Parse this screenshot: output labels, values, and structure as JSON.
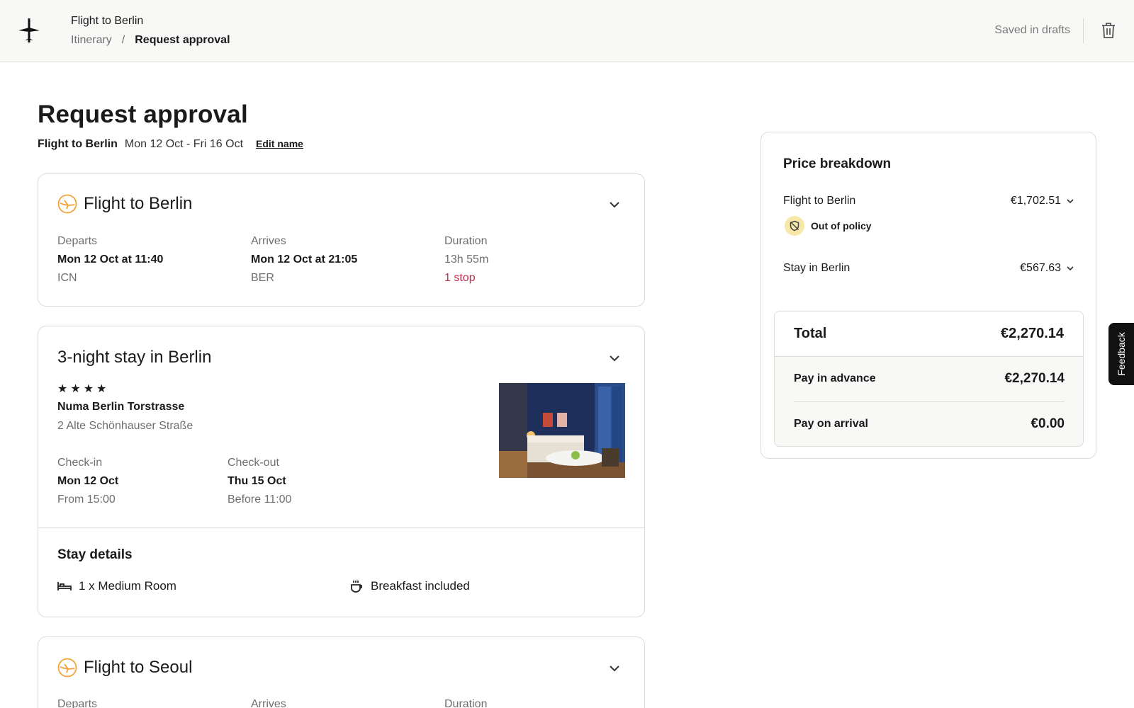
{
  "topbar": {
    "title": "Flight to Berlin",
    "breadcrumb": [
      "Itinerary",
      "Request approval"
    ],
    "breadcrumb_separator": "/",
    "status": "Saved in drafts",
    "logo_icon": "plane-icon",
    "delete_icon": "trash-icon"
  },
  "header": {
    "title": "Request approval",
    "trip_name": "Flight to Berlin",
    "dates": "Mon 12 Oct - Fri 16 Oct",
    "edit_label": "Edit name"
  },
  "flight_out": {
    "title": "Flight to Berlin",
    "departs_label": "Departs",
    "departs": "Mon 12 Oct at 11:40",
    "departs_airport": "ICN",
    "arrives_label": "Arrives",
    "arrives": "Mon 12 Oct at 21:05",
    "arrives_airport": "BER",
    "duration_label": "Duration",
    "duration": "13h 55m",
    "stops": "1 stop"
  },
  "stay": {
    "title": "3-night stay in Berlin",
    "stars": "★★★★",
    "hotel": "Numa Berlin Torstrasse",
    "address": "2 Alte Schönhauser Straße",
    "checkin_label": "Check-in",
    "checkin": "Mon 12 Oct",
    "checkin_time": "From 15:00",
    "checkout_label": "Check-out",
    "checkout": "Thu 15 Oct",
    "checkout_time": "Before 11:00",
    "details_title": "Stay details",
    "room": "1 x Medium Room",
    "breakfast": "Breakfast included"
  },
  "flight_back": {
    "title": "Flight to Seoul",
    "departs_label": "Departs",
    "arrives_label": "Arrives",
    "duration_label": "Duration"
  },
  "price": {
    "title": "Price breakdown",
    "items": [
      {
        "label": "Flight to Berlin",
        "amount": "€1,702.51"
      },
      {
        "label": "Stay in Berlin",
        "amount": "€567.63"
      }
    ],
    "policy_label": "Out of policy",
    "total_label": "Total",
    "total": "€2,270.14",
    "advance_label": "Pay in advance",
    "advance": "€2,270.14",
    "arrival_label": "Pay on arrival",
    "arrival": "€0.00"
  },
  "feedback_label": "Feedback",
  "colors": {
    "topbar_bg": "#f8f8f6",
    "border": "#dcdcd8",
    "muted_text": "#6f6f6f",
    "stop_red": "#c0304e",
    "airline_orange": "#f2a33a",
    "policy_yellow": "#f7e7a8"
  }
}
